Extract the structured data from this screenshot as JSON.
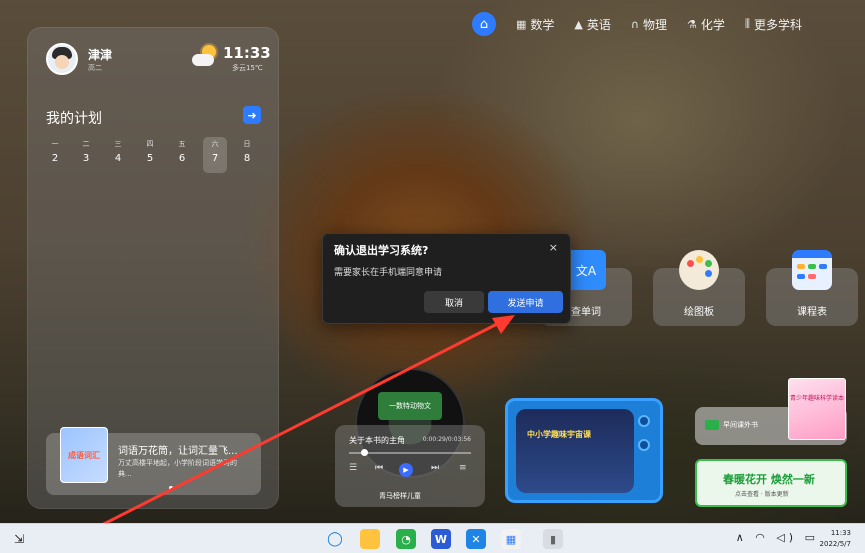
{
  "nav": {
    "items": [
      {
        "icon": "math-icon",
        "glyph": "▦",
        "label": "数学"
      },
      {
        "icon": "english-icon",
        "glyph": "▲",
        "label": "英语"
      },
      {
        "icon": "physics-icon",
        "glyph": "∩",
        "label": "物理"
      },
      {
        "icon": "chemistry-icon",
        "glyph": "⚗",
        "label": "化学"
      },
      {
        "icon": "more-subjects-icon",
        "glyph": "⫼",
        "label": "更多学科"
      }
    ]
  },
  "profile": {
    "name": "津津",
    "grade": "高二"
  },
  "weather": {
    "time": "11:33",
    "desc": "多云15℃"
  },
  "plan": {
    "title": "我的计划",
    "days": [
      {
        "weekday": "一",
        "date": "2"
      },
      {
        "weekday": "二",
        "date": "3"
      },
      {
        "weekday": "三",
        "date": "4"
      },
      {
        "weekday": "四",
        "date": "5"
      },
      {
        "weekday": "五",
        "date": "6"
      },
      {
        "weekday": "六",
        "date": "7"
      },
      {
        "weekday": "日",
        "date": "8"
      }
    ]
  },
  "recommend": {
    "thumb": "成语词汇",
    "title": "词语万花筒，让词汇量飞...",
    "desc": "万丈高楼平地起，小学阶段词语学习的典..."
  },
  "apps": {
    "lookup": "查单词",
    "draw": "绘图板",
    "schedule": "课程表"
  },
  "music": {
    "disc_label": "一数特动物文",
    "title": "关于本书的主角",
    "time": "0:00:29/0:03:56",
    "source": "青马榜样儿童"
  },
  "tv": {
    "screen_text": "中小学趣味宇宙课"
  },
  "books": {
    "card_label": "早间课外书",
    "cover_text": "青少年趣味科学读本",
    "spring_title": "春暖花开 焕然一新",
    "spring_sub": "点击查看 · 版本更新"
  },
  "dialog": {
    "title": "确认退出学习系统?",
    "message": "需要家长在手机端同意申请",
    "close": "×",
    "cancel": "取消",
    "send": "发送申请"
  },
  "taskbar": {
    "clock_time": "11:33",
    "clock_date": "2022/5/7",
    "tray": "∧ ◠ ◁) ▭"
  }
}
